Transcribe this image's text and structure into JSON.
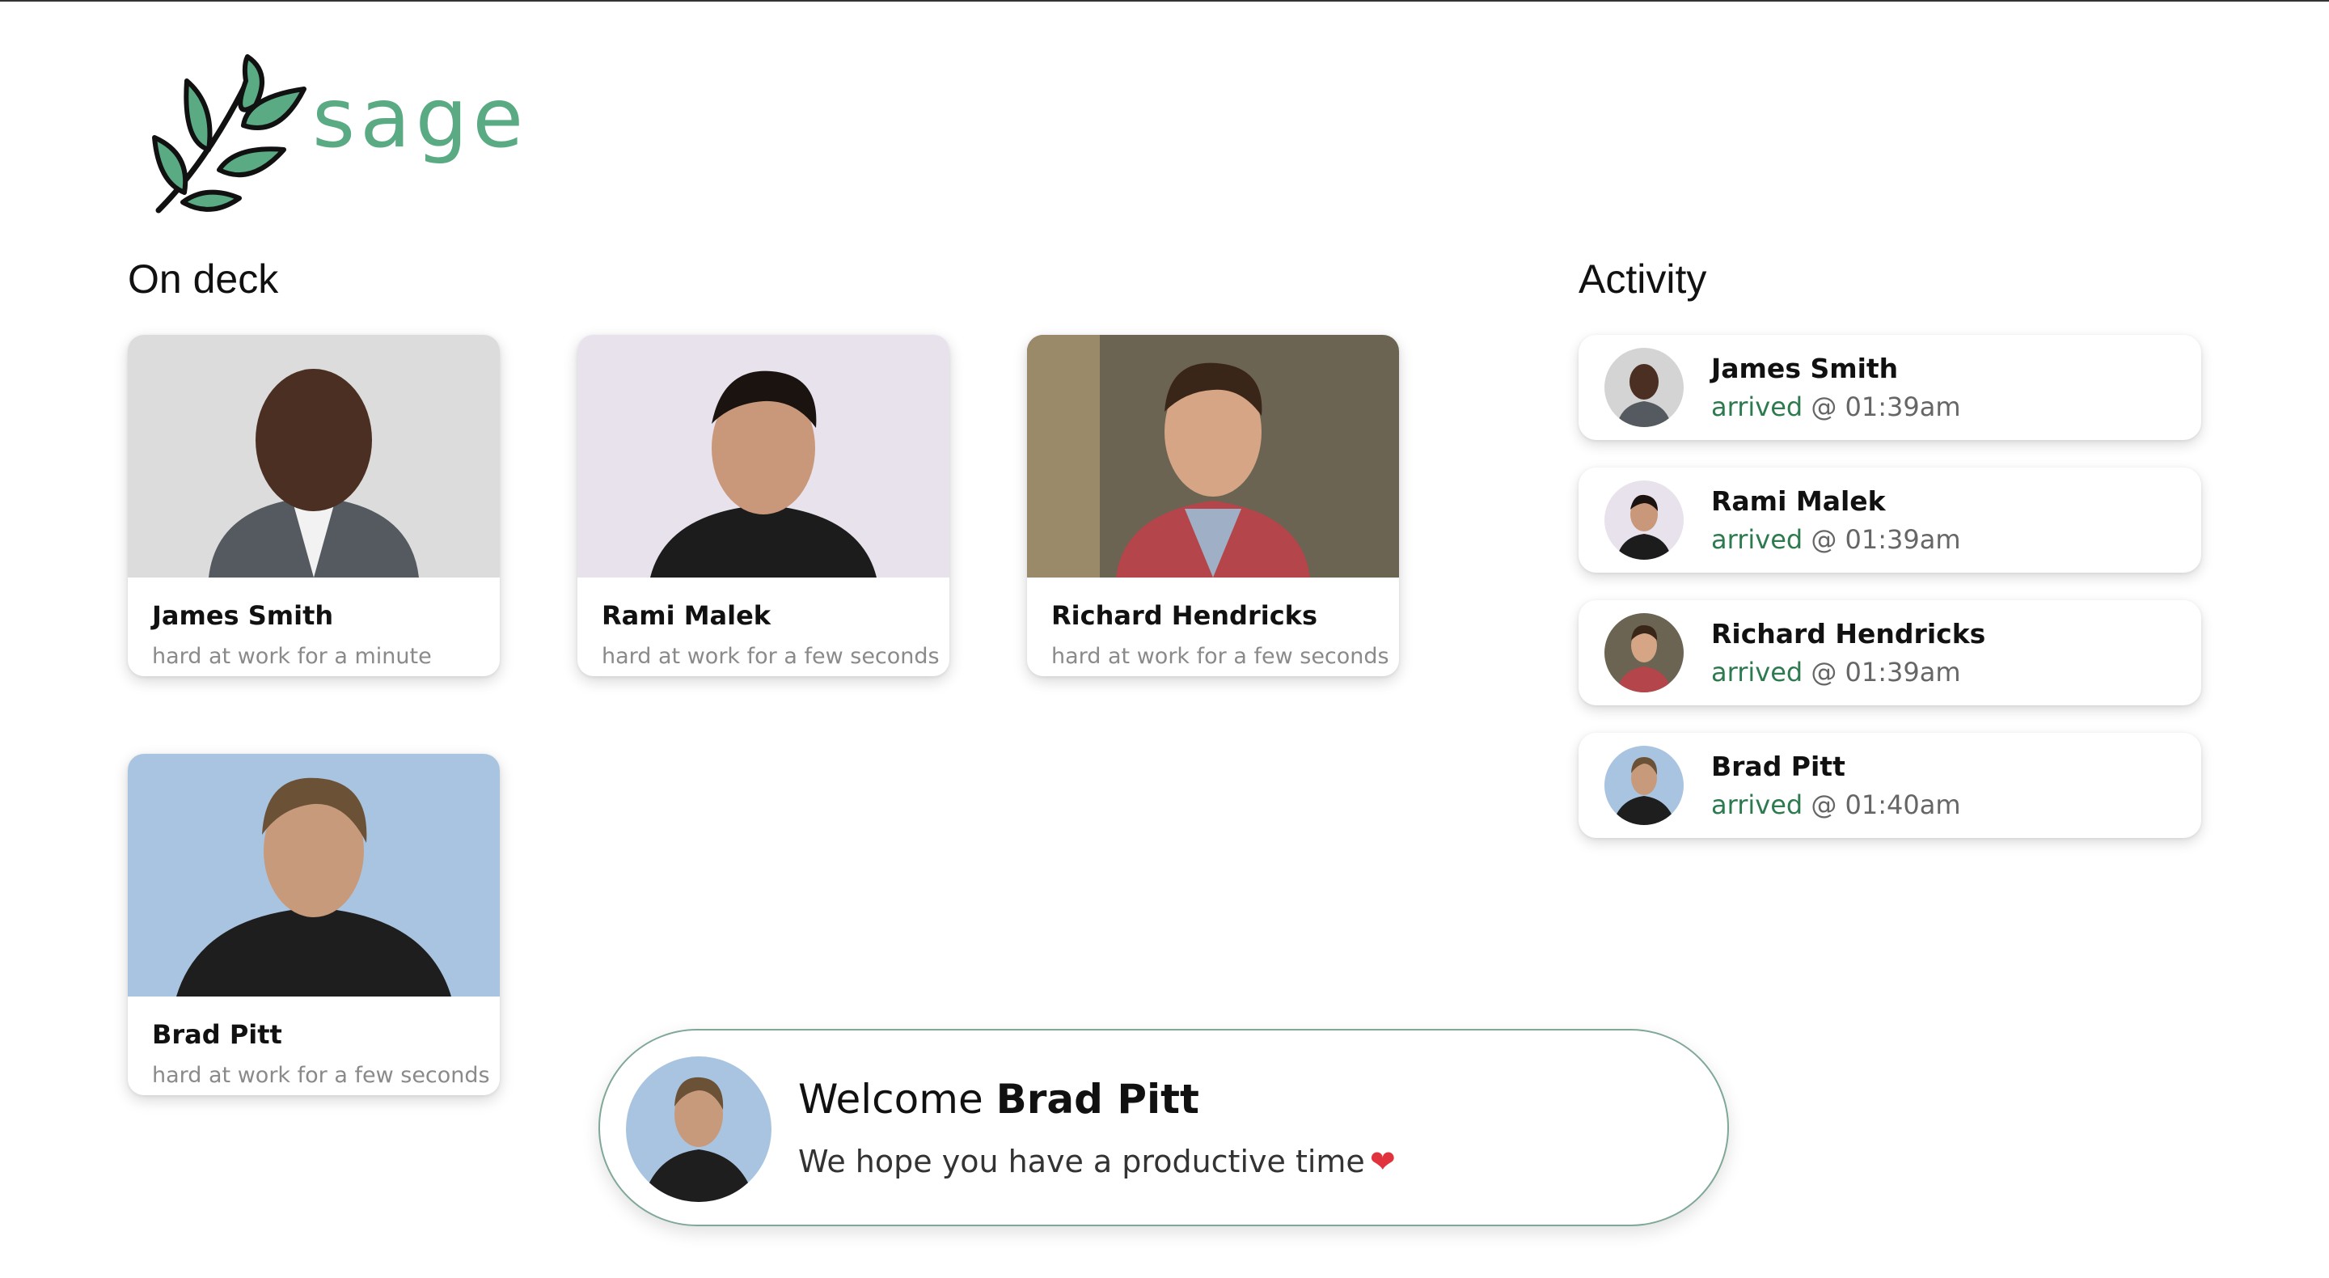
{
  "brand": {
    "name": "sage",
    "accent": "#5aaa84",
    "logo_icon": "leaf-branch-icon"
  },
  "on_deck": {
    "title": "On deck",
    "cards": [
      {
        "name": "James Smith",
        "status": "hard at work for a minute",
        "photo_icon": "person-photo"
      },
      {
        "name": "Rami Malek",
        "status": "hard at work for a few seconds",
        "photo_icon": "person-photo"
      },
      {
        "name": "Richard Hendricks",
        "status": "hard at work for a few seconds",
        "photo_icon": "person-photo"
      },
      {
        "name": "Brad Pitt",
        "status": "hard at work for a few seconds",
        "photo_icon": "person-photo"
      }
    ]
  },
  "activity": {
    "title": "Activity",
    "items": [
      {
        "name": "James Smith",
        "verb": "arrived",
        "time": "@ 01:39am"
      },
      {
        "name": "Rami Malek",
        "verb": "arrived",
        "time": "@ 01:39am"
      },
      {
        "name": "Richard Hendricks",
        "verb": "arrived",
        "time": "@ 01:39am"
      },
      {
        "name": "Brad Pitt",
        "verb": "arrived",
        "time": "@ 01:40am"
      }
    ]
  },
  "welcome_toast": {
    "greeting": "Welcome",
    "name": "Brad Pitt",
    "message": "We hope you have a productive time",
    "heart_icon": "heart-icon",
    "heart_color": "#e0333d"
  }
}
